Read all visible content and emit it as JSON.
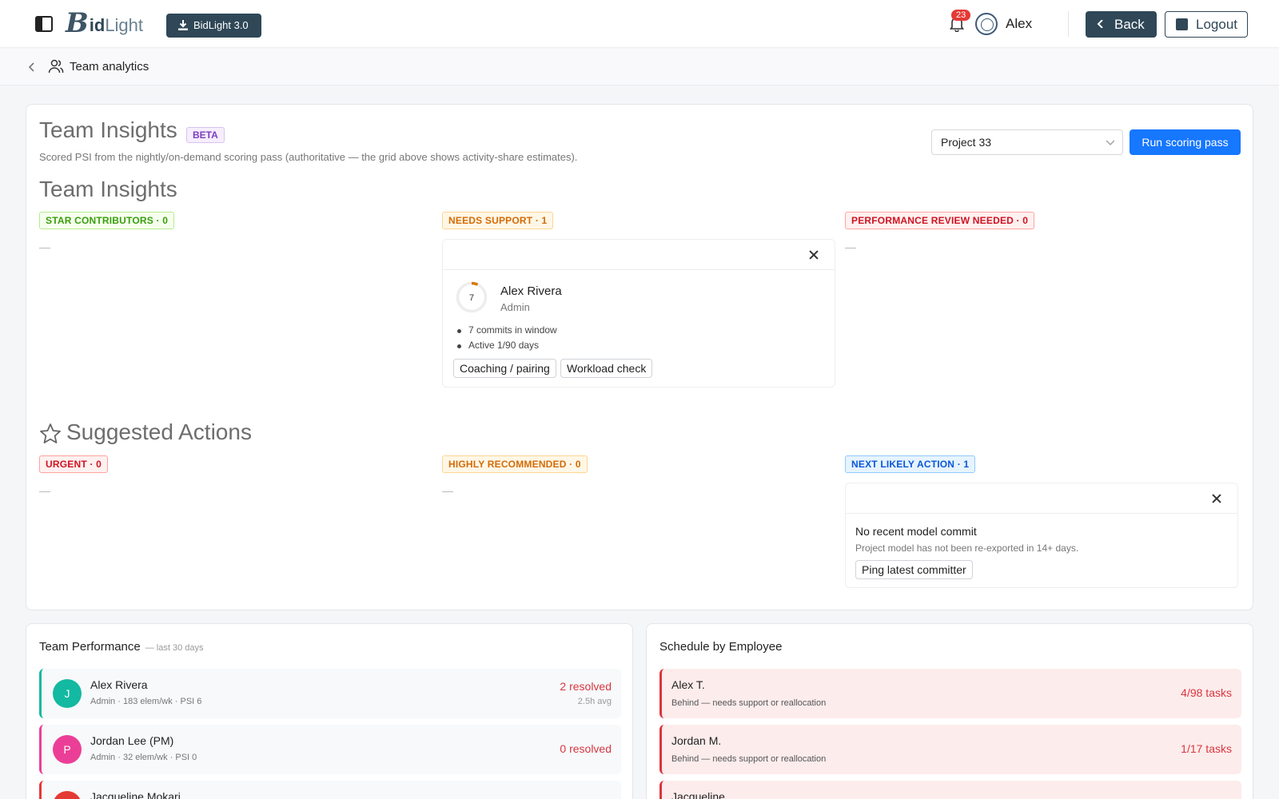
{
  "app": {
    "logo_bold": "id",
    "logo_light": "Light",
    "download_label": "BidLight 3.0",
    "notification_count": "23",
    "user_name": "Alex",
    "back_label": "Back",
    "logout_label": "Logout"
  },
  "breadcrumb": {
    "title": "Team analytics"
  },
  "insights": {
    "title": "Team Insights",
    "beta": "BETA",
    "subtitle": "Scored PSI from the nightly/on-demand scoring pass (authoritative — the grid above shows activity-share estimates).",
    "project": "Project 33",
    "run_label": "Run scoring pass",
    "section_title": "Team Insights",
    "star_tag": "STAR CONTRIBUTORS · 0",
    "support_tag": "NEEDS SUPPORT · 1",
    "review_tag": "PERFORMANCE REVIEW NEEDED · 0",
    "empty": "—",
    "support_card": {
      "score": "7",
      "score_fraction": 0.07,
      "name": "Alex Rivera",
      "role": "Admin",
      "bullets": [
        "7 commits in window",
        "Active 1/90 days"
      ],
      "chips": [
        "Coaching / pairing",
        "Workload check"
      ]
    }
  },
  "actions": {
    "title": "Suggested Actions",
    "urgent_tag": "URGENT · 0",
    "recommended_tag": "HIGHLY RECOMMENDED · 0",
    "next_tag": "NEXT LIKELY ACTION · 1",
    "card": {
      "title": "No recent model commit",
      "subtitle": "Project model has not been re-exported in 14+ days.",
      "chip": "Ping latest committer"
    }
  },
  "performance": {
    "title": "Team Performance",
    "subtitle": "— last 30 days",
    "rows": [
      {
        "initial": "J",
        "name": "Alex Rivera",
        "meta": "Admin · 183 elem/wk · PSI 6",
        "resolved": "2 resolved",
        "avg": "2.5h avg",
        "color": "#13b9a0"
      },
      {
        "initial": "P",
        "name": "Jordan Lee (PM)",
        "meta": "Admin · 32 elem/wk · PSI 0",
        "resolved": "0 resolved",
        "avg": "",
        "color": "#eb3f97"
      },
      {
        "initial": "",
        "name": "Jacqueline Mokari",
        "meta": "",
        "resolved": "",
        "avg": "",
        "color": "#e53935"
      }
    ]
  },
  "schedule": {
    "title": "Schedule by Employee",
    "rows": [
      {
        "name": "Alex T.",
        "status": "Behind — needs support or reallocation",
        "tasks": "4/98 tasks"
      },
      {
        "name": "Jordan M.",
        "status": "Behind — needs support or reallocation",
        "tasks": "1/17 tasks"
      },
      {
        "name": "Jacqueline",
        "status": "",
        "tasks": ""
      }
    ]
  },
  "colors": {
    "brand_dark": "#2f4757",
    "primary": "#1677ff",
    "danger": "#d9363e",
    "ring": "#d97706"
  }
}
